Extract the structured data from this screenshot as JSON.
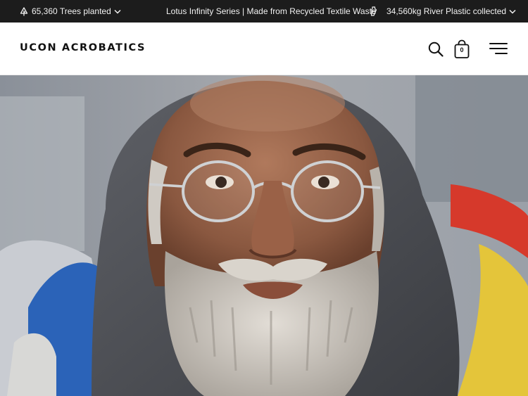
{
  "announcement": {
    "trees_text": "65,360 Trees planted",
    "series_text": "Lotus Infinity Series | Made from Recycled Textile Waste",
    "plastic_text": "34,560kg River Plastic collected"
  },
  "header": {
    "logo_text": "UCON ACROBATICS",
    "cart_count": "0",
    "icons": [
      "search-icon",
      "shopping-bag-icon",
      "menu-icon"
    ]
  },
  "hero": {
    "content": "photo-of-bearded-man-with-glasses-wrapped-in-knit-hood"
  },
  "colors": {
    "announcement_bg": "#1c1c1c",
    "header_bg": "#ffffff",
    "text": "#111111"
  }
}
